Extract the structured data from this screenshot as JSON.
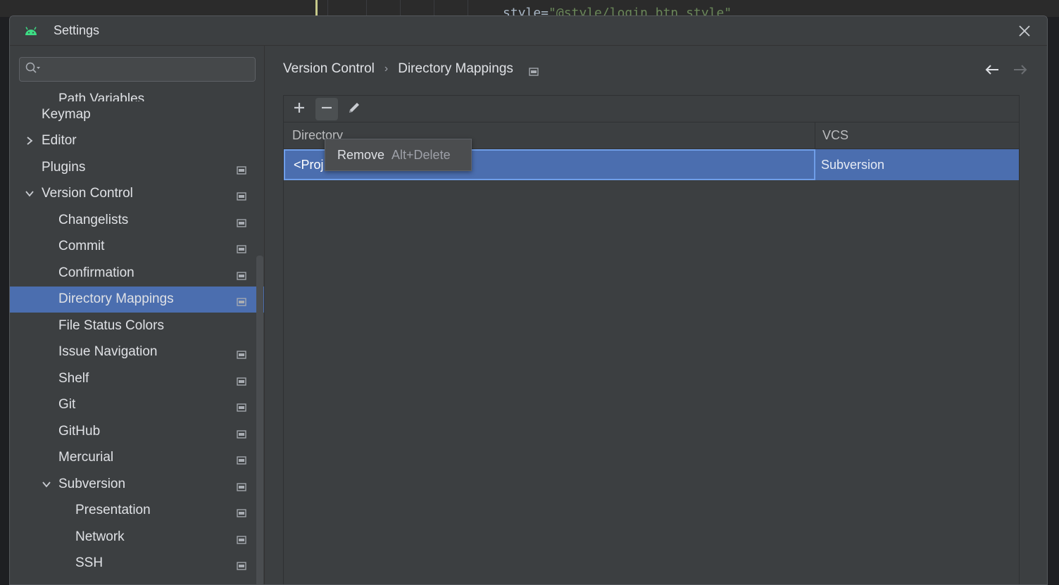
{
  "editor": {
    "code_prefix": "style=",
    "code_string": "\"@style/login_btn_style\""
  },
  "dialog": {
    "title": "Settings",
    "icons": {
      "logo": "android-icon",
      "close": "close-icon"
    }
  },
  "sidebar": {
    "search": {
      "placeholder": "",
      "value": ""
    },
    "items": [
      {
        "label": "Path Variables",
        "level": 1,
        "partial": true
      },
      {
        "label": "Keymap",
        "level": 0
      },
      {
        "label": "Editor",
        "level": 0,
        "expandable": true,
        "expanded": false
      },
      {
        "label": "Plugins",
        "level": 0,
        "project": true
      },
      {
        "label": "Version Control",
        "level": 0,
        "expandable": true,
        "expanded": true,
        "project": true
      },
      {
        "label": "Changelists",
        "level": 1,
        "project": true
      },
      {
        "label": "Commit",
        "level": 1,
        "project": true
      },
      {
        "label": "Confirmation",
        "level": 1,
        "project": true
      },
      {
        "label": "Directory Mappings",
        "level": 1,
        "project": true,
        "selected": true
      },
      {
        "label": "File Status Colors",
        "level": 1
      },
      {
        "label": "Issue Navigation",
        "level": 1,
        "project": true
      },
      {
        "label": "Shelf",
        "level": 1,
        "project": true
      },
      {
        "label": "Git",
        "level": 1,
        "project": true
      },
      {
        "label": "GitHub",
        "level": 1,
        "project": true
      },
      {
        "label": "Mercurial",
        "level": 1,
        "project": true
      },
      {
        "label": "Subversion",
        "level": 1,
        "expandable": true,
        "expanded": true,
        "project": true
      },
      {
        "label": "Presentation",
        "level": 2,
        "project": true
      },
      {
        "label": "Network",
        "level": 2,
        "project": true
      },
      {
        "label": "SSH",
        "level": 2,
        "project": true
      }
    ]
  },
  "breadcrumb": {
    "parent": "Version Control",
    "separator": "›",
    "current": "Directory Mappings"
  },
  "toolbar": {
    "add_icon": "plus-icon",
    "remove_icon": "minus-icon",
    "edit_icon": "pencil-icon"
  },
  "table": {
    "columns": {
      "directory": "Directory",
      "vcs": "VCS"
    },
    "rows": [
      {
        "directory": "<Proj",
        "vcs": "Subversion"
      }
    ]
  },
  "tooltip": {
    "label": "Remove",
    "shortcut": "Alt+Delete"
  },
  "colors": {
    "selection": "#4b6eaf",
    "android_green": "#3ddc84",
    "background": "#3c3f41"
  }
}
